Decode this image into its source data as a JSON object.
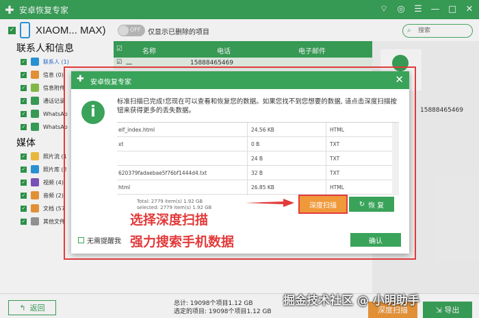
{
  "app": {
    "title": "安卓恢复专家",
    "logo": "✚"
  },
  "window_controls": [
    "wifi-icon",
    "feedback-icon",
    "menu-icon",
    "minimize-icon",
    "maximize-icon",
    "close-icon"
  ],
  "device": {
    "name": "XIAOM... MAX)"
  },
  "toggle": {
    "label": "OFF",
    "text": "仅显示已删除的项目"
  },
  "search": {
    "placeholder": "搜索"
  },
  "sections": {
    "contacts_title": "联系人和信息",
    "media_title": "媒体"
  },
  "contact_categories": [
    {
      "label": "联系人 (1)",
      "color": "#2b9be0",
      "icon": "person"
    },
    {
      "label": "信息 (0)",
      "color": "#f0993a",
      "icon": "msg"
    },
    {
      "label": "信息附件",
      "color": "#8bc34a",
      "icon": "clip"
    },
    {
      "label": "通话记录",
      "color": "#3aa35a",
      "icon": "phone"
    },
    {
      "label": "WhatsAp",
      "color": "#3aa35a",
      "icon": "wa"
    },
    {
      "label": "WhatsAp",
      "color": "#3aa35a",
      "icon": "wa"
    }
  ],
  "media_categories": [
    {
      "label": "照片流 (1",
      "color": "#f6c343",
      "icon": "star"
    },
    {
      "label": "照片库 (2",
      "color": "#2b9be0",
      "icon": "img"
    },
    {
      "label": "视频 (4)",
      "color": "#7e57c2",
      "icon": "video"
    },
    {
      "label": "音频 (2)",
      "color": "#f0993a",
      "icon": "audio"
    },
    {
      "label": "文档 (57",
      "color": "#f0993a",
      "icon": "doc"
    },
    {
      "label": "其他文件",
      "color": "#999999",
      "icon": "other"
    }
  ],
  "table": {
    "headers": [
      "名称",
      "电话",
      "电子邮件"
    ],
    "row1": {
      "name": "一",
      "phone": "15888465469"
    }
  },
  "right_panel": {
    "phone": "15888465469"
  },
  "dialog": {
    "title": "安卓恢复专家",
    "message": "标准扫描已完成!您现在可以查看和恢复您的数据。如果您找不到您想要的数据, 请点击深度扫描按钮来获得更多的丢失数据。",
    "files": [
      {
        "name": "elf_index.html",
        "size": "24.56 KB",
        "type": "HTML"
      },
      {
        "name": "xt",
        "size": "0 B",
        "type": "TXT"
      },
      {
        "name": "",
        "size": "24 B",
        "type": "TXT"
      },
      {
        "name": "620379fadaebae5f76bf1444d4.txt",
        "size": "32 B",
        "type": "TXT"
      },
      {
        "name": "html",
        "size": "26.85 KB",
        "type": "HTML"
      }
    ],
    "total": "Total: 2779 item(s) 1.92 GB",
    "selected": "selected: 2779 item(s) 1.92 GB",
    "deep_scan": "深度扫描",
    "recover": "恢 复",
    "annotation_line1": "选择深度扫描",
    "annotation_line2": "强力搜索手机数据",
    "no_remind": "无需提醒我",
    "confirm": "确认"
  },
  "bottom": {
    "back": "返回",
    "total": "总计: 19098个项目1.12 GB",
    "selected": "选定的项目: 19098个项目1.12 GB",
    "deep_scan": "深度扫描",
    "export": "导出"
  },
  "watermark": "掘金技术社区 @ 小明助手"
}
